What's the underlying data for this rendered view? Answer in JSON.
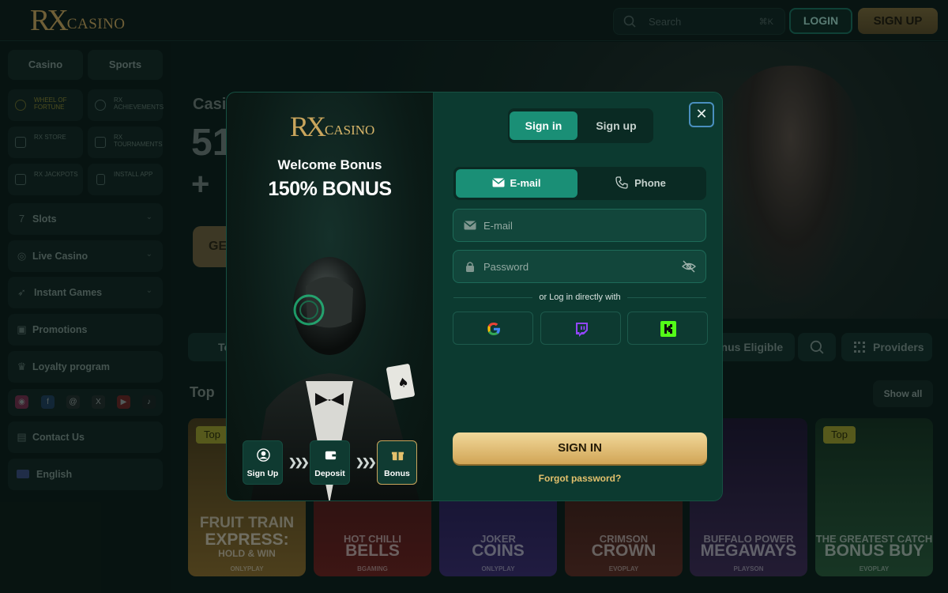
{
  "header": {
    "logo_rx": "RX",
    "logo_casino": "CASINO",
    "search_placeholder": "Search",
    "search_shortcut": "⌘K",
    "login_label": "LOGIN",
    "signup_label": "SIGN UP"
  },
  "sidebar": {
    "tabs": [
      "Casino",
      "Sports"
    ],
    "tiles": [
      {
        "label": "WHEEL OF FORTUNE",
        "icon": "wheel-icon"
      },
      {
        "label": "RX ACHIEVEMENTS",
        "icon": "medal-icon"
      },
      {
        "label": "RX STORE",
        "icon": "bag-icon"
      },
      {
        "label": "RX TOURNAMENTS",
        "icon": "trophy-icon"
      },
      {
        "label": "RX JACKPOTS",
        "icon": "jackpot-icon"
      },
      {
        "label": "INSTALL APP",
        "icon": "phone-icon"
      }
    ],
    "menu": [
      {
        "label": "Slots",
        "icon": "slots-icon"
      },
      {
        "label": "Live Casino",
        "icon": "live-icon"
      },
      {
        "label": "Instant Games",
        "icon": "rocket-icon"
      },
      {
        "label": "Promotions",
        "icon": "gift-icon"
      },
      {
        "label": "Loyalty program",
        "icon": "crown-icon"
      }
    ],
    "socials": [
      "instagram-icon",
      "facebook-icon",
      "threads-icon",
      "x-icon",
      "youtube-icon",
      "tiktok-icon"
    ],
    "contact_label": "Contact Us",
    "language_label": "English"
  },
  "main": {
    "hero_line1": "Casi",
    "hero_line2": "51",
    "hero_line3": "+",
    "hero_button": "GE",
    "filter_left": "To",
    "filter_bonus": "onus Eligible",
    "filter_providers": "Providers",
    "section_title": "Top",
    "show_all": "Show all",
    "games": [
      {
        "badge": "Top",
        "line1": "FRUIT TRAIN",
        "line2": "EXPRESS:",
        "line3": "ONLYPLAY",
        "sub": "HOLD & WIN",
        "color": "#8a6a2a"
      },
      {
        "badge": "",
        "line1": "HOT CHILLI",
        "line2": "BELLS",
        "line3": "BGAMING",
        "color": "#6e1f1c"
      },
      {
        "badge": "",
        "line1": "JOKER",
        "line2": "COINS",
        "line3": "ONLYPLAY",
        "color": "#3a2a6e"
      },
      {
        "badge": "",
        "line1": "CRIMSON",
        "line2": "CROWN",
        "line3": "EVOPLAY",
        "color": "#5e2b22"
      },
      {
        "badge": "",
        "line1": "BUFFALO POWER",
        "line2": "MEGAWAYS",
        "line3": "PLAYSON",
        "color": "#3e2a55"
      },
      {
        "badge": "Top",
        "line1": "THE GREATEST CATCH",
        "line2": "BONUS BUY",
        "line3": "EVOPLAY",
        "color": "#2a5a3a"
      }
    ]
  },
  "modal": {
    "logo_rx": "RX",
    "logo_casino": "CASINO",
    "welcome_title": "Welcome Bonus",
    "bonus_big": "150% BONUS",
    "steps": [
      {
        "label": "Sign Up",
        "icon": "user-icon"
      },
      {
        "label": "Deposit",
        "icon": "wallet-icon"
      },
      {
        "label": "Bonus",
        "icon": "gift-icon"
      }
    ],
    "tab_signin": "Sign in",
    "tab_signup": "Sign up",
    "method_email": "E-mail",
    "method_phone": "Phone",
    "email_placeholder": "E-mail",
    "password_placeholder": "Password",
    "or_text": "or Log in directly with",
    "social_logins": [
      "google-icon",
      "twitch-icon",
      "kick-icon"
    ],
    "signin_button": "SIGN IN",
    "forgot_password": "Forgot password?",
    "close_symbol": "✕"
  }
}
